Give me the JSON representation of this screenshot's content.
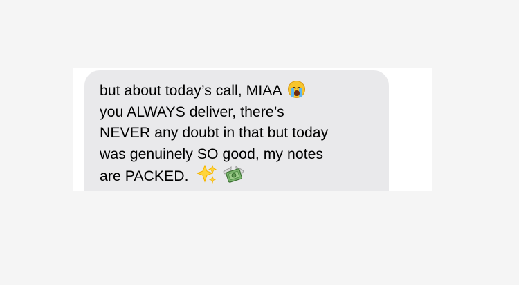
{
  "message": {
    "lines": [
      "but about today’s call, MIAA",
      "you ALWAYS deliver, there’s",
      "NEVER any doubt in that but today",
      "was genuinely SO good, my notes",
      "are PACKED."
    ],
    "emojis": {
      "line_1": "crying-face-icon",
      "line_5": [
        "sparkles-icon",
        "money-with-wings-icon"
      ]
    },
    "colors": {
      "bubble": "#e9e9eb",
      "text": "#000000",
      "page": "#f5f5f5",
      "card": "#ffffff"
    }
  }
}
